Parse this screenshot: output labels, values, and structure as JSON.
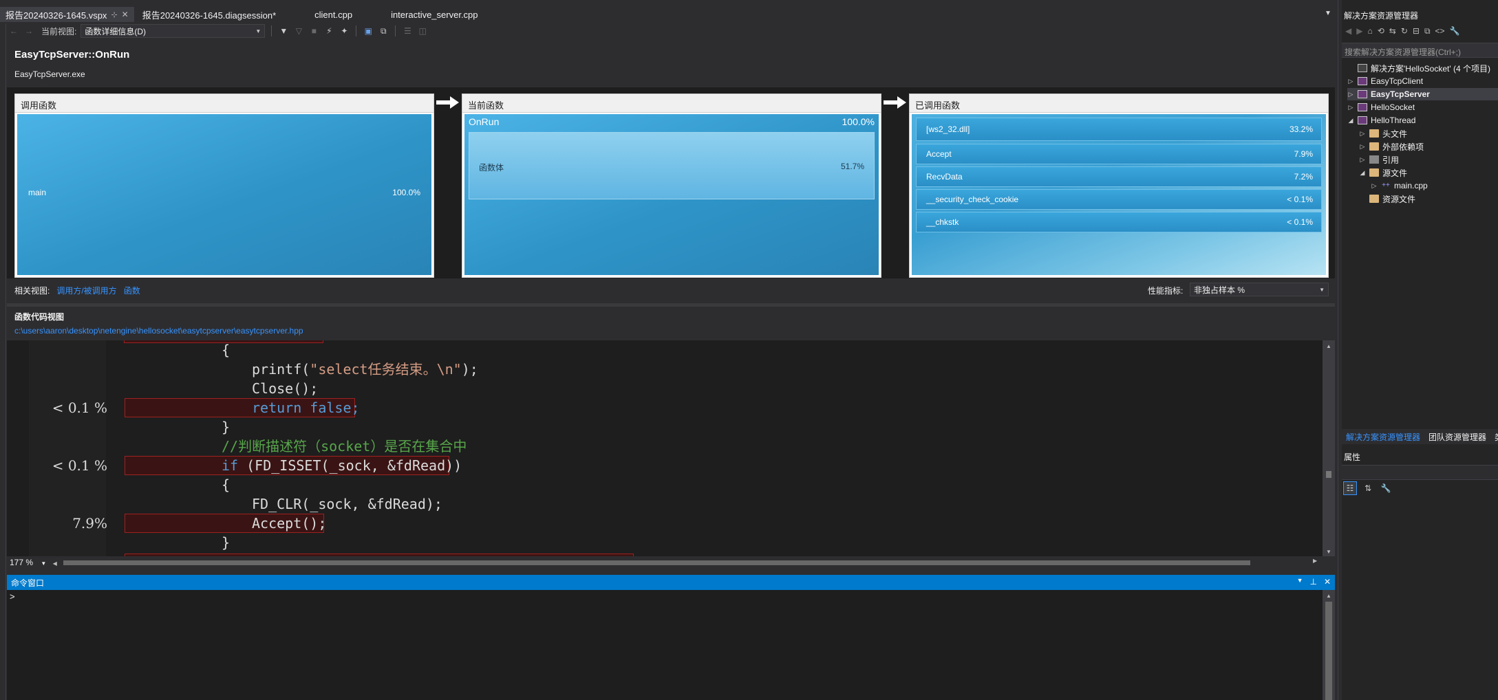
{
  "tabs": [
    {
      "label": "报告20240326-1645.vspx",
      "active": true
    },
    {
      "label": "报告20240326-1645.diagsession*",
      "active": false
    },
    {
      "label": "client.cpp",
      "active": false
    },
    {
      "label": "interactive_server.cpp",
      "active": false
    }
  ],
  "toolbar": {
    "view_label": "当前视图:",
    "view_value": "函数详细信息(D)"
  },
  "header": {
    "function_name": "EasyTcpServer::OnRun",
    "module": "EasyTcpServer.exe"
  },
  "callers_panel": {
    "title": "调用函数",
    "items": [
      {
        "name": "main",
        "percent": "100.0%"
      }
    ]
  },
  "current_panel": {
    "title": "当前函数",
    "name": "OnRun",
    "percent": "100.0%",
    "body_label": "函数体",
    "body_percent": "51.7%"
  },
  "callees_panel": {
    "title": "已调用函数",
    "items": [
      {
        "name": "[ws2_32.dll]",
        "percent": "33.2%"
      },
      {
        "name": "Accept",
        "percent": "7.9%"
      },
      {
        "name": "RecvData",
        "percent": "7.2%"
      },
      {
        "name": "__security_check_cookie",
        "percent": "< 0.1%"
      },
      {
        "name": "__chkstk",
        "percent": "< 0.1%"
      }
    ]
  },
  "related_views": {
    "label": "相关视图:",
    "link1": "调用方/被调用方",
    "link2": "函数"
  },
  "metric": {
    "label": "性能指标:",
    "value": "非独占样本 %"
  },
  "code_view": {
    "title": "函数代码视图",
    "path": "c:\\users\\aaron\\desktop\\netengine\\hellosocket\\easytcpserver\\easytcpserver.hpp",
    "zoom": "177 %",
    "lines": [
      {
        "pct": "",
        "text": "{"
      },
      {
        "pct": "",
        "text": "printf(\"select任务结束。\\n\");"
      },
      {
        "pct": "",
        "text": "Close();"
      },
      {
        "pct": "< 0.1 %",
        "text": "return false;"
      },
      {
        "pct": "",
        "text": "}"
      },
      {
        "pct": "",
        "text": "//判断描述符（socket）是否在集合中"
      },
      {
        "pct": "< 0.1 %",
        "text": "if (FD_ISSET(_sock, &fdRead))"
      },
      {
        "pct": "",
        "text": "{"
      },
      {
        "pct": "",
        "text": "FD_CLR(_sock, &fdRead);"
      },
      {
        "pct": "7.9%",
        "text": "Accept();"
      },
      {
        "pct": "",
        "text": "}"
      }
    ]
  },
  "command_window": {
    "title": "命令窗口",
    "prompt": ">"
  },
  "solution_explorer": {
    "title": "解决方案资源管理器",
    "search_placeholder": "搜索解决方案资源管理器(Ctrl+;)",
    "tree": [
      {
        "label": "解决方案'HelloSocket' (4 个项目)"
      },
      {
        "label": "EasyTcpClient"
      },
      {
        "label": "EasyTcpServer"
      },
      {
        "label": "HelloSocket"
      },
      {
        "label": "HelloThread"
      },
      {
        "label": "头文件"
      },
      {
        "label": "外部依赖项"
      },
      {
        "label": "引用"
      },
      {
        "label": "源文件"
      },
      {
        "label": "main.cpp"
      },
      {
        "label": "资源文件"
      }
    ],
    "bottom_tabs": [
      "解决方案资源管理器",
      "团队资源管理器",
      "类"
    ]
  },
  "properties": {
    "title": "属性"
  },
  "colors": {
    "accent": "#007acc",
    "link": "#3794ff",
    "panel_blue": "#2e94c8",
    "hot_line_border": "#a02020"
  }
}
